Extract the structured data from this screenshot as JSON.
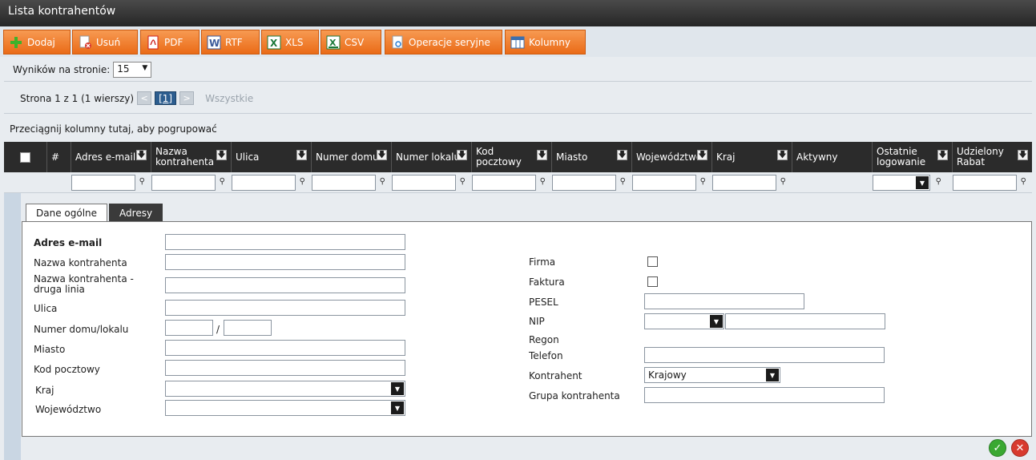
{
  "window": {
    "title": "Lista kontrahentów"
  },
  "toolbar": {
    "add": "Dodaj",
    "delete": "Usuń",
    "pdf": "PDF",
    "rtf": "RTF",
    "xls": "XLS",
    "csv": "CSV",
    "bulk": "Operacje seryjne",
    "columns": "Kolumny",
    "accent": "#ea6b17"
  },
  "perpage": {
    "label": "Wyników na stronie:",
    "value": "15"
  },
  "pager": {
    "info": "Strona 1 z 1 (1 wierszy)",
    "prev": "<",
    "current": "[1]",
    "next": ">",
    "all": "Wszystkie"
  },
  "groupby": {
    "hint": "Przeciągnij kolumny tutaj, aby pogrupować"
  },
  "grid": {
    "columns": {
      "num": "#",
      "email": "Adres e-mail",
      "name": "Nazwa kontrahenta",
      "street": "Ulica",
      "house": "Numer domu",
      "flat": "Numer lokalu",
      "zip": "Kod pocztowy",
      "city": "Miasto",
      "province": "Województwo",
      "country": "Kraj",
      "active": "Aktywny",
      "lastlogin": "Ostatnie logowanie",
      "discount": "Udzielony Rabat"
    }
  },
  "tabs": {
    "general": "Dane ogólne",
    "addresses": "Adresy"
  },
  "form": {
    "email": "Adres e-mail",
    "name": "Nazwa kontrahenta",
    "name2": "Nazwa kontrahenta - druga linia",
    "street": "Ulica",
    "houseflat": "Numer domu/lokalu",
    "slash": "/",
    "city": "Miasto",
    "zip": "Kod pocztowy",
    "country": "Kraj",
    "province": "Województwo",
    "company": "Firma",
    "invoice": "Faktura",
    "pesel": "PESEL",
    "nip": "NIP",
    "regon": "Regon",
    "phone": "Telefon",
    "ktype": "Kontrahent",
    "ktype_value": "Krajowy",
    "group": "Grupa kontrahenta"
  }
}
